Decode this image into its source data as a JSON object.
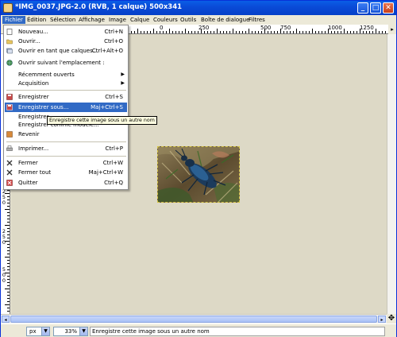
{
  "window": {
    "title": "*IMG_0037.JPG-2.0 (RVB, 1 calque) 500x341",
    "controls": [
      "minimize-icon",
      "maximize-icon",
      "close-icon"
    ]
  },
  "menubar": {
    "items": [
      "Fichier",
      "Édition",
      "Sélection",
      "Affichage",
      "Image",
      "Calque",
      "Couleurs",
      "Outils",
      "Boîte de dialogue",
      "Filtres"
    ]
  },
  "ruler": {
    "top_labels": [
      "0",
      "250",
      "500",
      "750",
      "1000",
      "1250"
    ],
    "left_labels": [
      "2",
      "5",
      "0",
      "2",
      "5",
      "0",
      "5",
      "0",
      "0"
    ]
  },
  "file_menu": {
    "items": [
      {
        "label": "Nouveau...",
        "shortcut": "Ctrl+N",
        "icon": "new-icon"
      },
      {
        "label": "Ouvrir...",
        "shortcut": "Ctrl+O",
        "icon": "open-icon"
      },
      {
        "label": "Ouvrir en tant que calques...",
        "shortcut": "Ctrl+Alt+O",
        "icon": "open-layers-icon"
      },
      {
        "label": "Ouvrir suivant l'emplacement :",
        "shortcut": "",
        "icon": "globe-icon"
      },
      {
        "label": "Récemment ouverts",
        "shortcut": "",
        "icon": "",
        "submenu": true
      },
      {
        "label": "Acquisition",
        "shortcut": "",
        "icon": "",
        "submenu": true
      },
      {
        "label": "Enregistrer",
        "shortcut": "Ctrl+S",
        "icon": "save-icon"
      },
      {
        "label": "Enregistrer sous...",
        "shortcut": "Maj+Ctrl+S",
        "icon": "save-as-icon"
      },
      {
        "label": "Enregistrer",
        "shortcut": "",
        "icon": ""
      },
      {
        "label": "Enregistrer comme modèle...",
        "shortcut": "",
        "icon": ""
      },
      {
        "label": "Revenir",
        "shortcut": "",
        "icon": "revert-icon"
      },
      {
        "label": "Imprimer...",
        "shortcut": "Ctrl+P",
        "icon": "print-icon"
      },
      {
        "label": "Fermer",
        "shortcut": "Ctrl+W",
        "icon": "close-x-icon"
      },
      {
        "label": "Fermer tout",
        "shortcut": "Maj+Ctrl+W",
        "icon": "close-all-icon"
      },
      {
        "label": "Quitter",
        "shortcut": "Ctrl+Q",
        "icon": "quit-icon"
      }
    ],
    "highlighted_index": 7
  },
  "tooltip": "Enregistre cette image sous un autre nom",
  "statusbar": {
    "unit": "px",
    "zoom": "33%",
    "message": "Enregistre cette image sous un autre nom"
  }
}
